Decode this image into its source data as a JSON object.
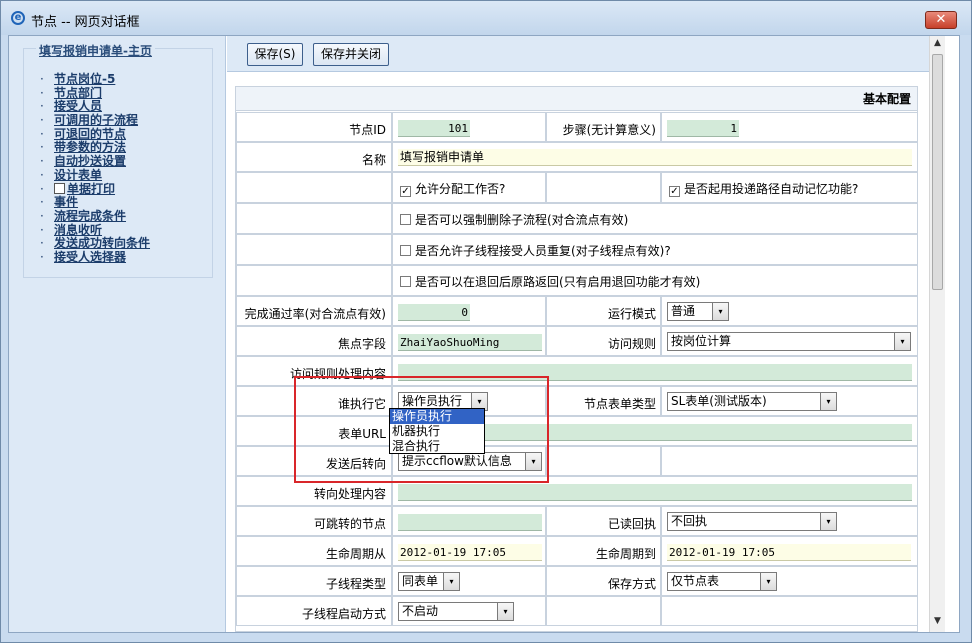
{
  "window": {
    "title": "节点 -- 网页对话框",
    "close_label": "✕"
  },
  "nav": {
    "title": "填写报销申请单-主页",
    "items": [
      "节点岗位-5",
      "节点部门",
      "接受人员",
      "可调用的子流程",
      "可退回的节点",
      "带参数的方法",
      "自动抄送设置",
      "设计表单",
      "单据打印",
      "事件",
      "流程完成条件",
      "消息收听",
      "发送成功转向条件",
      "接受人选择器"
    ],
    "bullet": "·"
  },
  "toolbar": {
    "save_label": "保存(S)",
    "save_close_label": "保存并关闭"
  },
  "form": {
    "section_title": "基本配置",
    "node_id_label": "节点ID",
    "node_id_value": "101",
    "step_label": "步骤(无计算意义)",
    "step_value": "1",
    "name_label": "名称",
    "name_value": "填写报销申请单",
    "cb_allow_assign": "允许分配工作否?",
    "cb_allow_assign_checked": true,
    "cb_auto_remember": "是否起用投递路径自动记忆功能?",
    "cb_auto_remember_checked": true,
    "cb_force_delete": "是否可以强制删除子流程(对合流点有效)",
    "cb_force_delete_checked": false,
    "cb_repeat_receiver": "是否允许子线程接受人员重复(对子线程点有效)?",
    "cb_repeat_receiver_checked": false,
    "cb_return_back": "是否可以在退回后原路返回(只有启用退回功能才有效)",
    "cb_return_back_checked": false,
    "pass_rate_label": "完成通过率(对合流点有效)",
    "pass_rate_value": "0",
    "run_mode_label": "运行模式",
    "run_mode_value": "普通",
    "focus_field_label": "焦点字段",
    "focus_field_value": "ZhaiYaoShuoMing",
    "access_rule_label": "访问规则",
    "access_rule_value": "按岗位计算",
    "access_rule_content_label": "访问规则处理内容",
    "executor_label": "谁执行它",
    "executor_value": "操作员执行",
    "form_type_label": "节点表单类型",
    "form_type_value": "SL表单(测试版本)",
    "form_url_label": "表单URL",
    "after_send_label": "发送后转向",
    "after_send_value": "提示ccflow默认信息",
    "turn_content_label": "转向处理内容",
    "jump_node_label": "可跳转的节点",
    "read_receipt_label": "已读回执",
    "read_receipt_value": "不回执",
    "life_from_label": "生命周期从",
    "life_from_value": "2012-01-19 17:05",
    "life_to_label": "生命周期到",
    "life_to_value": "2012-01-19 17:05",
    "subthread_type_label": "子线程类型",
    "subthread_type_value": "同表单",
    "save_mode_label": "保存方式",
    "save_mode_value": "仅节点表",
    "subthread_start_label": "子线程启动方式",
    "subthread_start_value": "不启动"
  },
  "executor_options": [
    "操作员执行",
    "机器执行",
    "混合执行"
  ],
  "icons": {
    "dropdown": "▾",
    "check": "✓",
    "scroll_up": "▲",
    "scroll_down": "▼"
  },
  "colors": {
    "highlight_box": "#d9262a",
    "selected_option": "#3163c5",
    "readonly_field": "#d3ead9"
  }
}
